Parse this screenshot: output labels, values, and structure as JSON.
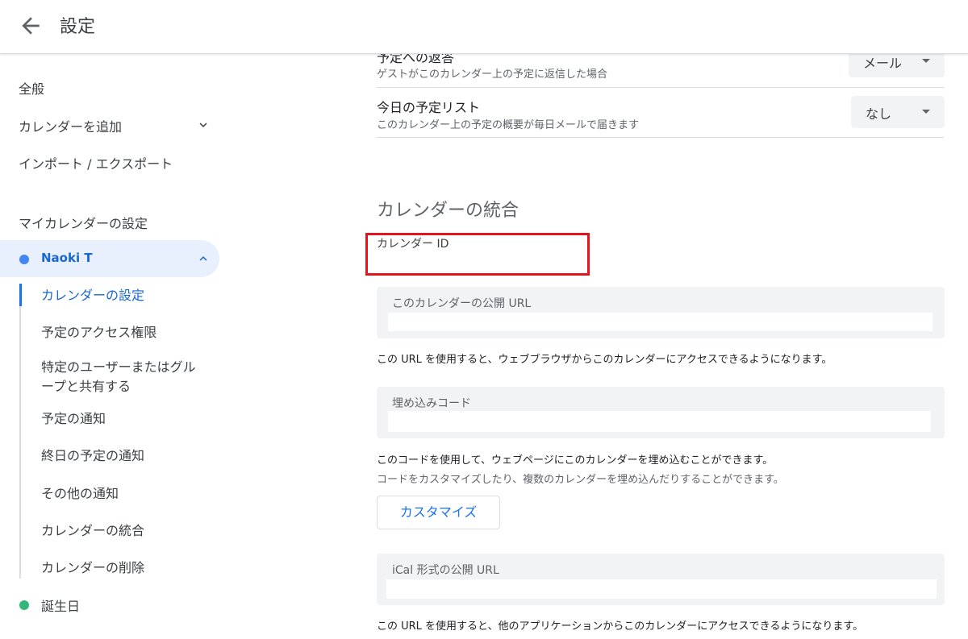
{
  "header": {
    "title": "設定",
    "back_icon": "arrow-back-icon"
  },
  "sidebar": {
    "general": "全般",
    "add_calendar": "カレンダーを追加",
    "import_export": "インポート / エクスポート",
    "my_calendars_heading": "マイカレンダーの設定",
    "calendar": {
      "name": "Naoki T",
      "color": "#4285f4"
    },
    "subnav": [
      "カレンダーの設定",
      "予定のアクセス権限",
      "特定のユーザーまたはグループと共有する",
      "予定の通知",
      "終日の予定の通知",
      "その他の通知",
      "カレンダーの統合",
      "カレンダーの削除"
    ],
    "birthday": {
      "name": "誕生日",
      "color": "#33b679"
    }
  },
  "main": {
    "reply_row": {
      "title": "予定への返答",
      "desc": "ゲストがこのカレンダー上の予定に返信した場合",
      "value": "メール"
    },
    "agenda_row": {
      "title": "今日の予定リスト",
      "desc": "このカレンダー上の予定の概要が毎日メールで届きます",
      "value": "なし"
    },
    "integration_heading": "カレンダーの統合",
    "calendar_id_label": "カレンダー ID",
    "public_url": {
      "label": "このカレンダーの公開 URL",
      "value": "",
      "info": "この URL を使用すると、ウェブブラウザからこのカレンダーにアクセスできるようになります。"
    },
    "embed_code": {
      "label": "埋め込みコード",
      "value": "",
      "info": "このコードを使用して、ウェブページにこのカレンダーを埋め込むことができます。",
      "sub_info": "コードをカスタマイズしたり、複数のカレンダーを埋め込んだりすることができます。",
      "customize_label": "カスタマイズ"
    },
    "ical_url": {
      "label": "iCal 形式の公開 URL",
      "value": "",
      "info": "この URL を使用すると、他のアプリケーションからこのカレンダーにアクセスできるようになります。"
    }
  },
  "colors": {
    "accent": "#1a73e8",
    "highlight": "#e3141b"
  }
}
